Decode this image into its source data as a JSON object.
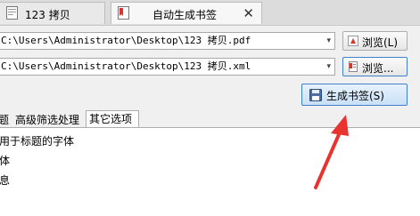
{
  "tabs": [
    {
      "label": "123 拷贝",
      "active": false
    },
    {
      "label": "自动生成书签",
      "active": true
    }
  ],
  "tab_close_glyph": "✕",
  "pdf_path": {
    "value": "C:\\Users\\Administrator\\Desktop\\123 拷贝.pdf"
  },
  "xml_path": {
    "value": "C:\\Users\\Administrator\\Desktop\\123 拷贝.xml"
  },
  "dropdown_glyph": "▾",
  "browse_pdf_button": {
    "label": "浏览(L)",
    "icon": "pdf-icon"
  },
  "browse_xml_button": {
    "label": "浏览...",
    "icon": "document-icon"
  },
  "generate_button": {
    "label": "生成书签(S)",
    "icon": "save-icon"
  },
  "subtabs": [
    {
      "label": "题",
      "partial": true
    },
    {
      "label": "高级筛选处理",
      "partial": false
    },
    {
      "label": "其它选项",
      "active": true
    }
  ],
  "options": [
    "用于标题的字体",
    "体",
    "息"
  ],
  "colors": {
    "accent_arrow": "#e8332f",
    "gen_border": "#3f80c8"
  }
}
